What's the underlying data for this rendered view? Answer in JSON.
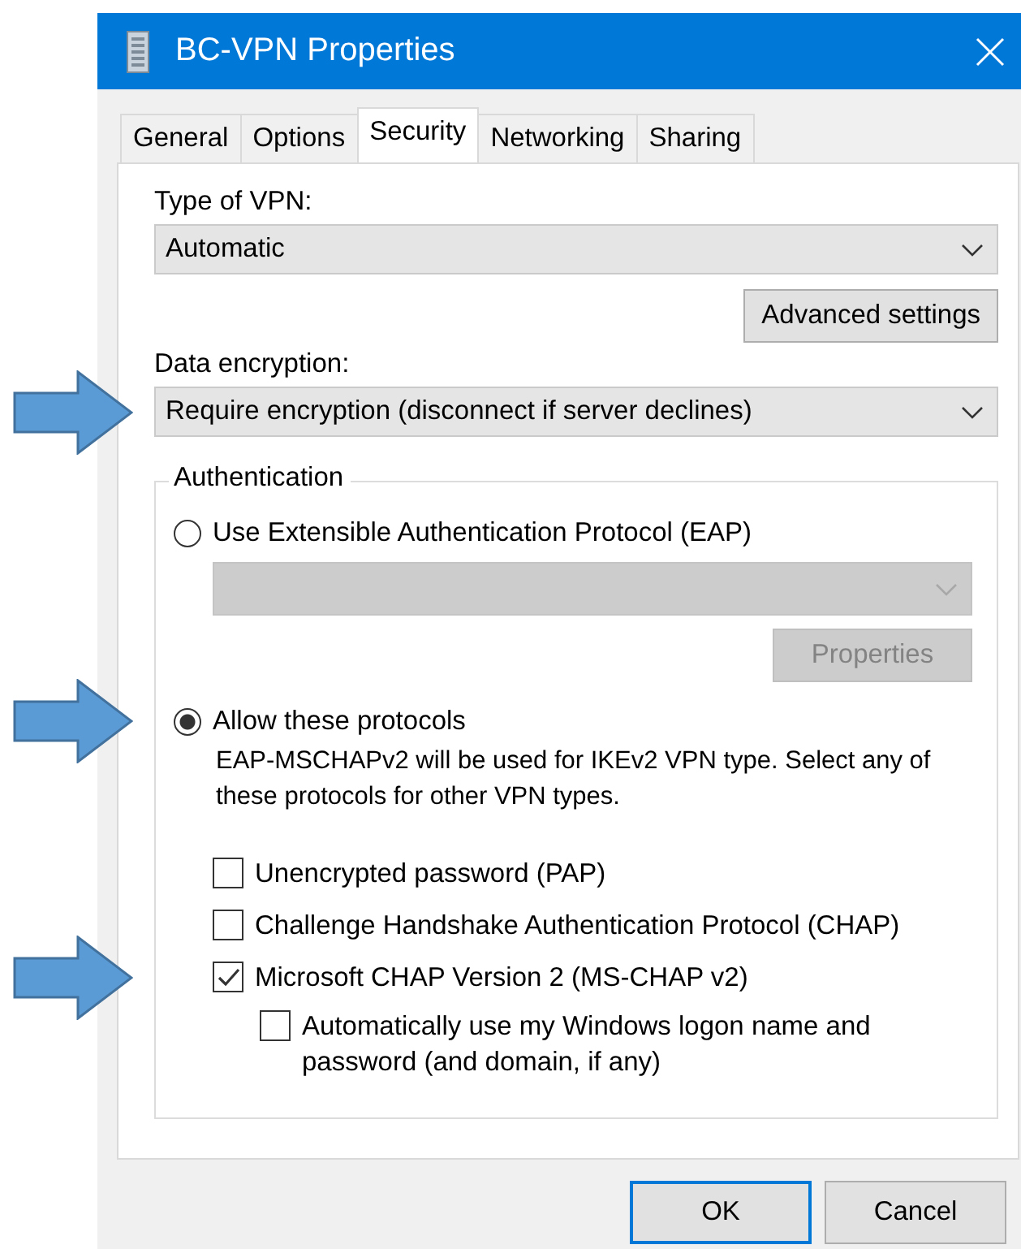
{
  "window": {
    "title": "BC-VPN Properties"
  },
  "tabs": [
    {
      "label": "General",
      "selected": false
    },
    {
      "label": "Options",
      "selected": false
    },
    {
      "label": "Security",
      "selected": true
    },
    {
      "label": "Networking",
      "selected": false
    },
    {
      "label": "Sharing",
      "selected": false
    }
  ],
  "type_of_vpn": {
    "label": "Type of VPN:",
    "value": "Automatic"
  },
  "advanced_button": {
    "label": "Advanced settings"
  },
  "data_encryption": {
    "label": "Data encryption:",
    "value": "Require encryption (disconnect if server declines)",
    "marked": true
  },
  "authentication": {
    "title": "Authentication",
    "options": [
      {
        "kind": "eap",
        "label": "Use Extensible Authentication Protocol (EAP)",
        "selected": false,
        "marked": false,
        "dropdown": {
          "disabled": true
        },
        "properties_button": {
          "label": "Properties",
          "disabled": true
        }
      },
      {
        "kind": "protocols",
        "label": "Allow these protocols",
        "selected": true,
        "marked": true,
        "note": "EAP-MSCHAPv2 will be used for IKEv2 VPN type. Select any of these protocols for other VPN types."
      }
    ],
    "protocols": [
      {
        "label": "Unencrypted password (PAP)",
        "checked": false,
        "marked": false
      },
      {
        "label": "Challenge Handshake Authentication Protocol (CHAP)",
        "checked": false,
        "marked": false
      },
      {
        "label": "Microsoft CHAP Version 2 (MS-CHAP v2)",
        "checked": true,
        "marked": true,
        "children": [
          {
            "label": "Automatically use my Windows logon name and password (and domain, if any)",
            "checked": false
          }
        ]
      }
    ]
  },
  "buttons": [
    {
      "label": "OK",
      "default": true
    },
    {
      "label": "Cancel",
      "default": false
    }
  ]
}
